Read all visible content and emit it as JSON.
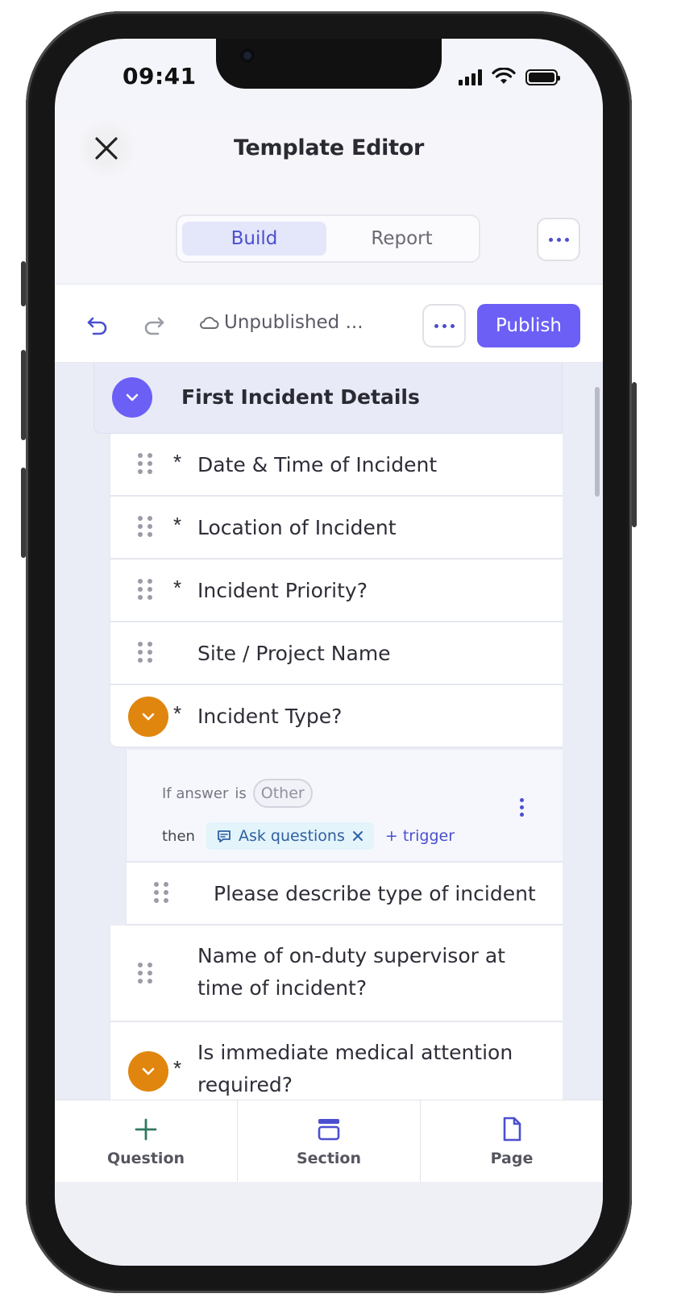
{
  "status_bar": {
    "time": "09:41"
  },
  "header": {
    "title": "Template Editor",
    "tabs": [
      {
        "label": "Build",
        "active": true
      },
      {
        "label": "Report",
        "active": false
      }
    ]
  },
  "toolbar": {
    "status": "Unpublished ...",
    "publish_label": "Publish"
  },
  "section": {
    "title": "First Incident Details"
  },
  "questions": [
    {
      "label": "Date & Time of Incident",
      "required": "*"
    },
    {
      "label": "Location of Incident",
      "required": "*"
    },
    {
      "label": "Incident Priority?",
      "required": "*"
    },
    {
      "label": "Site / Project Name",
      "required": ""
    },
    {
      "label": "Incident Type?",
      "required": "*"
    }
  ],
  "logic": {
    "if_text": "If answer",
    "is_text": "is",
    "answer_value": "Other",
    "then_text": "then",
    "action": "Ask questions",
    "trigger_label": "+ trigger"
  },
  "sub_question": {
    "label": "Please describe type of incident"
  },
  "more_questions": [
    {
      "label": "Name of on-duty supervisor at time of incident?",
      "required": ""
    },
    {
      "label": "Is immediate medical attention required?",
      "required": "*"
    }
  ],
  "bottom_nav": [
    {
      "label": "Question",
      "icon": "plus-icon"
    },
    {
      "label": "Section",
      "icon": "section-icon"
    },
    {
      "label": "Page",
      "icon": "page-icon"
    }
  ],
  "colors": {
    "accent": "#6c5ff6",
    "logic_orange": "#e0860e",
    "tab_active_bg": "#e4e6fa"
  }
}
